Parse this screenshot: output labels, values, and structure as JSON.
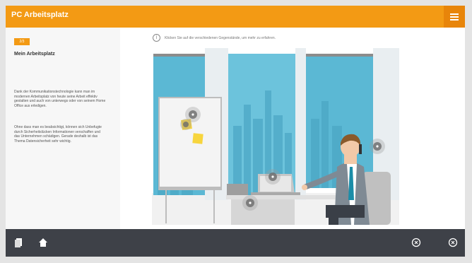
{
  "header": {
    "title": "PC Arbeitsplatz",
    "menu_icon": "hamburger-menu-icon"
  },
  "sidebar": {
    "chapter_badge": "2/3",
    "title": "Mein Arbeitsplatz",
    "paragraph1": "Dank der Kommunikationstechnologie kann man im modernen Arbeitsplatz von heute seine Arbeit effektiv gestalten und auch von unterwegs oder von seinem Home Office aus erledigen.",
    "paragraph2": "Ohne dass man es beabsichtigt, können sich Unbefugte durch Sicherheitslücken Informationen verschaffen und das Unternehmen schädigen. Gerade deshalb ist das Thema Datensicherheit sehr wichtig."
  },
  "main": {
    "instruction": "Klicken Sie auf die verschiedenen Gegenstände, um mehr zu erfahren.",
    "info_icon": "info-icon",
    "hotspots": [
      "whiteboard",
      "sticky-notes",
      "laptop",
      "desk-monitor",
      "person-phone"
    ]
  },
  "footer": {
    "icons": [
      "document-icon",
      "home-icon",
      "previous-circle-icon",
      "next-circle-icon"
    ]
  },
  "colors": {
    "accent": "#f39a14",
    "footer": "#3e4148",
    "sky": "#5bb8d4"
  }
}
